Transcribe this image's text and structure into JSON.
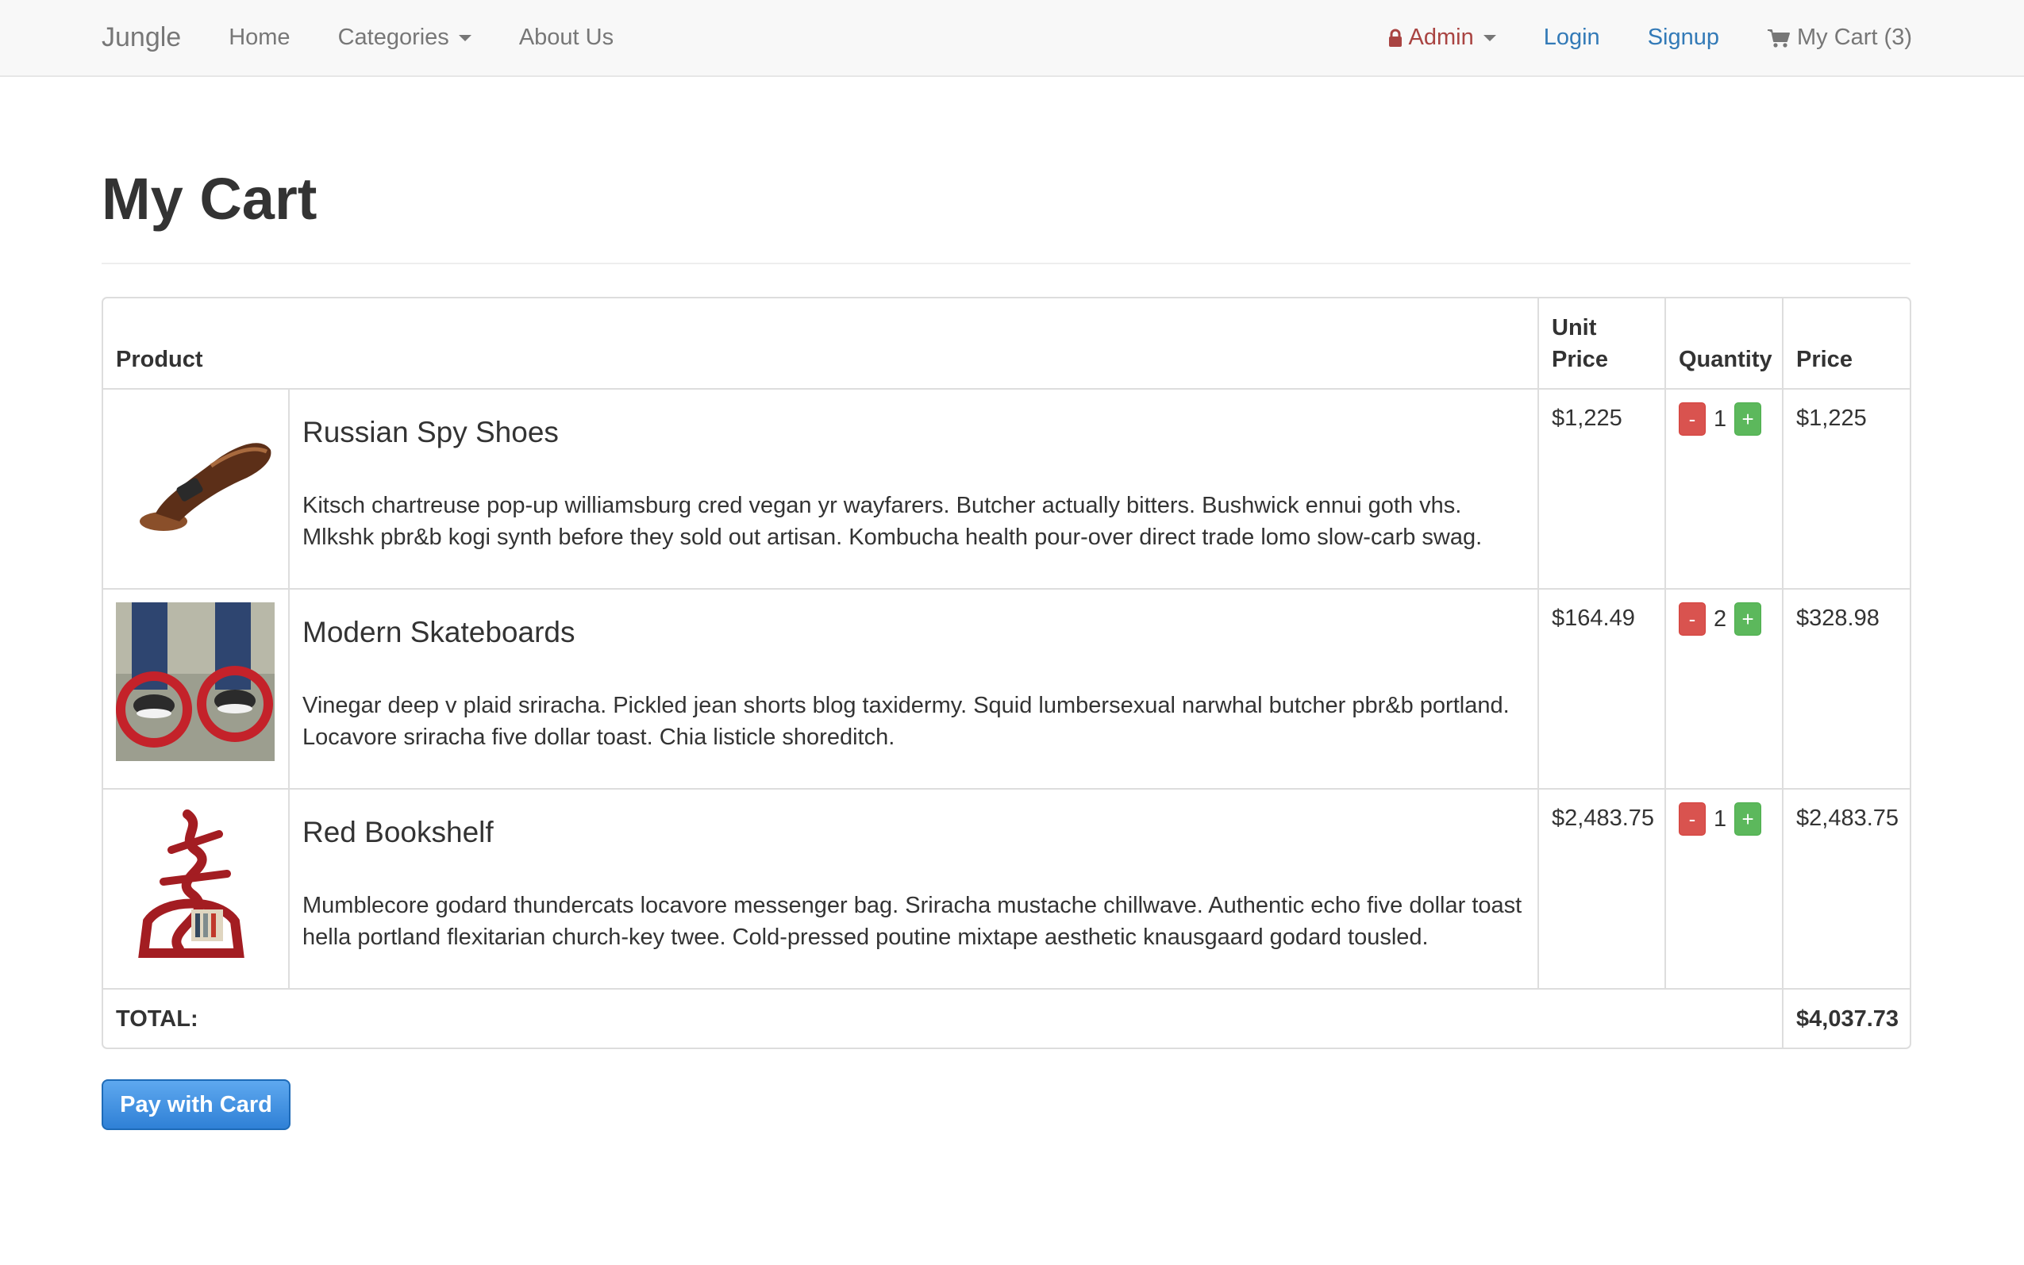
{
  "navbar": {
    "brand": "Jungle",
    "home": "Home",
    "categories": "Categories",
    "about": "About Us",
    "admin": "Admin",
    "login": "Login",
    "signup": "Signup",
    "cart": "My Cart (3)"
  },
  "page": {
    "title": "My Cart"
  },
  "table": {
    "headers": {
      "product": "Product",
      "unit_price": "Unit Price",
      "quantity": "Quantity",
      "price": "Price"
    },
    "rows": [
      {
        "name": "Russian Spy Shoes",
        "description": "Kitsch chartreuse pop-up williamsburg cred vegan yr wayfarers. Butcher actually bitters. Bushwick ennui goth vhs. Mlkshk pbr&b kogi synth before they sold out artisan. Kombucha health pour-over direct trade lomo slow-carb swag.",
        "unit_price": "$1,225",
        "quantity": "1",
        "price": "$1,225"
      },
      {
        "name": "Modern Skateboards",
        "description": "Vinegar deep v plaid sriracha. Pickled jean shorts blog taxidermy. Squid lumbersexual narwhal butcher pbr&b portland. Locavore sriracha five dollar toast. Chia listicle shoreditch.",
        "unit_price": "$164.49",
        "quantity": "2",
        "price": "$328.98"
      },
      {
        "name": "Red Bookshelf",
        "description": "Mumblecore godard thundercats locavore messenger bag. Sriracha mustache chillwave. Authentic echo five dollar toast hella portland flexitarian church-key twee. Cold-pressed poutine mixtape aesthetic knausgaard godard tousled.",
        "unit_price": "$2,483.75",
        "quantity": "1",
        "price": "$2,483.75"
      }
    ],
    "minus_label": "-",
    "plus_label": "+",
    "total_label": "TOTAL:",
    "total_value": "$4,037.73"
  },
  "pay_button": "Pay with Card",
  "colors": {
    "link": "#337ab7",
    "admin": "#a94442",
    "danger": "#d9534f",
    "success": "#5cb85c",
    "pay_button": "#2f80d6"
  },
  "icons": [
    "lock-icon",
    "caret-down-icon",
    "shopping-cart-icon"
  ]
}
